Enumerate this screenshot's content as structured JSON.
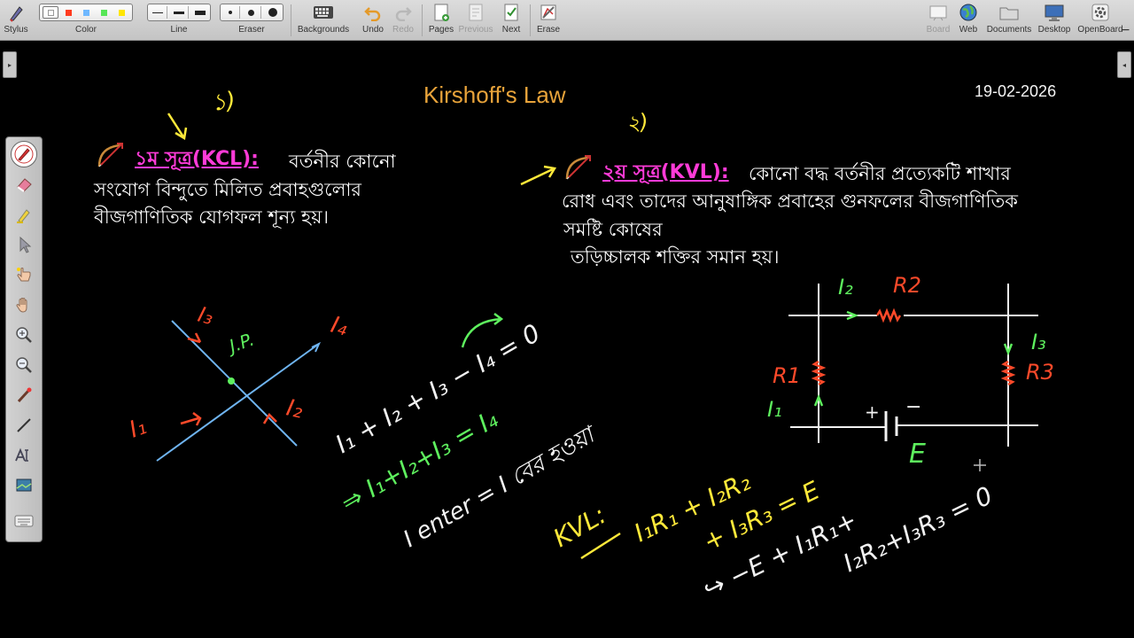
{
  "toolbar": {
    "stylus": "Stylus",
    "color": "Color",
    "line": "Line",
    "eraser": "Eraser",
    "backgrounds": "Backgrounds",
    "undo": "Undo",
    "redo": "Redo",
    "pages": "Pages",
    "previous": "Previous",
    "next": "Next",
    "erase": "Erase",
    "board": "Board",
    "web": "Web",
    "documents": "Documents",
    "desktop": "Desktop",
    "openboard": "OpenBoard",
    "colors": [
      "#ffffff",
      "#ff3b1f",
      "#6fb8ff",
      "#57e657",
      "#ffe600"
    ],
    "selected_color": "#ffffff"
  },
  "board": {
    "title": "Kirshoff's Law",
    "date": "19-02-2026",
    "marker_1": "১)",
    "marker_2": "২)",
    "kcl": {
      "heading": "১ম সূত্র(KCL):",
      "lines": [
        "বর্তনীর কোনো",
        "সংযোগ বিন্দুতে মিলিত প্রবাহগুলোর",
        "বীজগাণিতিক যোগফল শূন্য হয়।"
      ]
    },
    "kvl": {
      "heading": "২য় সূত্র(KVL):",
      "lines": [
        "কোনো বদ্ধ বর্তনীর প্রত্যেকটি শাখার",
        "রোধ এবং তাদের আনুষাঙ্গিক প্রবাহের গুনফলের বীজগাণিতিক",
        "সমষ্টি কোষের",
        "তড়িচ্চালক শক্তির সমান হয়।"
      ]
    },
    "junction": {
      "jp": "J.P.",
      "i1": "I₁",
      "i2": "I₂",
      "i3": "I₃",
      "i4": "I₄"
    },
    "equations": {
      "eq1": "I₁ + I₂ + I₃ − I₄ = 0",
      "eq2": "⇒ I₁+I₂+I₃ = I₄",
      "eq3": "I enter = I বের হওয়া"
    },
    "circuit": {
      "i2": "I₂",
      "r2": "R2",
      "i3": "I₃",
      "r3": "R3",
      "r1": "R1",
      "i1": "I₁",
      "plus": "+",
      "minus": "−",
      "e": "E"
    },
    "kvl_work": {
      "label": "KVL:",
      "line1": "I₁R₁ + I₂R₂",
      "line2": "+ I₃R₃ = E",
      "line3": "↪ −E + I₁R₁+",
      "line4": "I₂R₂+I₃R₃ = 0"
    },
    "ink_colors": {
      "white": "#f2f2f2",
      "red": "#ff4a2a",
      "green": "#5ef05e",
      "yellow": "#ffe93a",
      "blue": "#6fb4f0",
      "magenta": "#ff3bd8",
      "orange": "#e8a33a"
    }
  }
}
